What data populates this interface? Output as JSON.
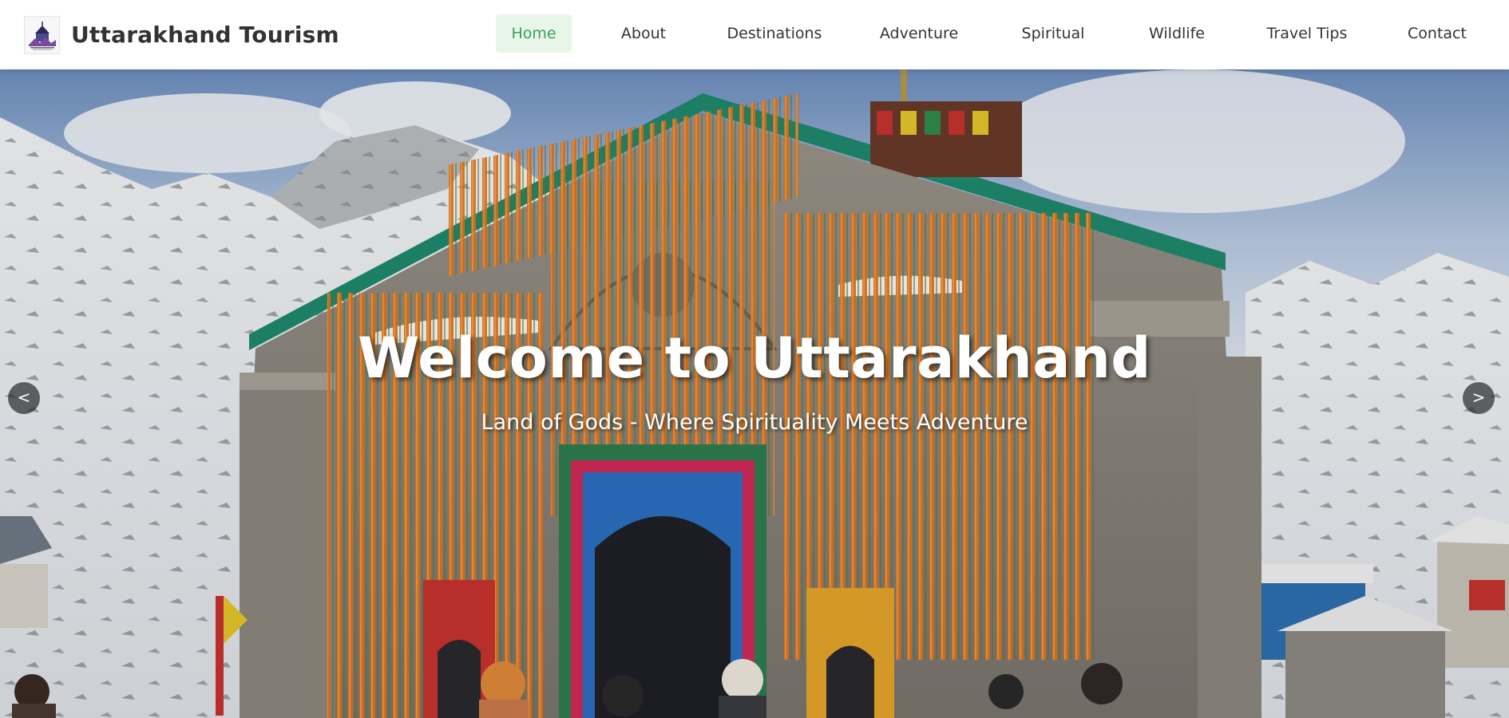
{
  "brand": {
    "title": "Uttarakhand Tourism",
    "logo_icon": "temple-mountain-logo"
  },
  "nav": {
    "items": [
      {
        "label": "Home",
        "active": true
      },
      {
        "label": "About",
        "active": false
      },
      {
        "label": "Destinations",
        "active": false
      },
      {
        "label": "Adventure",
        "active": false
      },
      {
        "label": "Spiritual",
        "active": false
      },
      {
        "label": "Wildlife",
        "active": false
      },
      {
        "label": "Travel Tips",
        "active": false
      },
      {
        "label": "Contact",
        "active": false
      }
    ]
  },
  "hero": {
    "title": "Welcome to Uttarakhand",
    "subtitle": "Land of Gods - Where Spirituality Meets Adventure",
    "prev_label": "<",
    "next_label": ">",
    "image_subject": "snow-covered-temple-with-marigold-garlands"
  },
  "colors": {
    "active_nav_bg": "#e8f5e9",
    "active_nav_text": "#3aa15a",
    "text": "#333333",
    "roof_green": "#1f8a6e",
    "marigold": "#e8751a"
  }
}
